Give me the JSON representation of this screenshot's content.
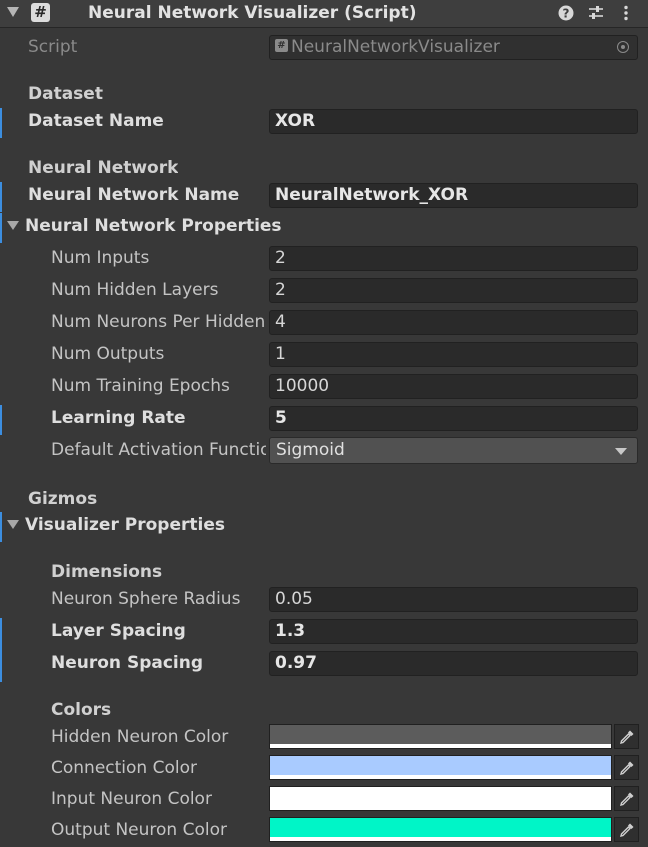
{
  "header": {
    "title": "Neural Network Visualizer (Script)"
  },
  "script": {
    "label": "Script",
    "value": "NeuralNetworkVisualizer"
  },
  "dataset": {
    "section": "Dataset",
    "name_label": "Dataset Name",
    "name_value": "XOR"
  },
  "network": {
    "section": "Neural Network",
    "name_label": "Neural Network Name",
    "name_value": "NeuralNetwork_XOR",
    "props_label": "Neural Network Properties",
    "num_inputs_label": "Num Inputs",
    "num_inputs": "2",
    "num_hidden_layers_label": "Num Hidden Layers",
    "num_hidden_layers": "2",
    "num_neurons_label": "Num Neurons Per Hidden Layer",
    "num_neurons": "4",
    "num_outputs_label": "Num Outputs",
    "num_outputs": "1",
    "num_epochs_label": "Num Training Epochs",
    "num_epochs": "10000",
    "learning_rate_label": "Learning Rate",
    "learning_rate": "5",
    "activation_label": "Default Activation Function",
    "activation": "Sigmoid"
  },
  "gizmos": {
    "section": "Gizmos",
    "props_label": "Visualizer Properties",
    "dimensions_label": "Dimensions",
    "radius_label": "Neuron Sphere Radius",
    "radius": "0.05",
    "layer_spacing_label": "Layer Spacing",
    "layer_spacing": "1.3",
    "neuron_spacing_label": "Neuron Spacing",
    "neuron_spacing": "0.97",
    "colors_label": "Colors",
    "hidden_color_label": "Hidden Neuron Color",
    "connection_color_label": "Connection Color",
    "input_color_label": "Input Neuron Color",
    "output_color_label": "Output Neuron Color"
  },
  "colors": {
    "hidden": "#5c5c5c",
    "connection": "#a9cbff",
    "input": "#ffffff",
    "output": "#00f5c7"
  }
}
